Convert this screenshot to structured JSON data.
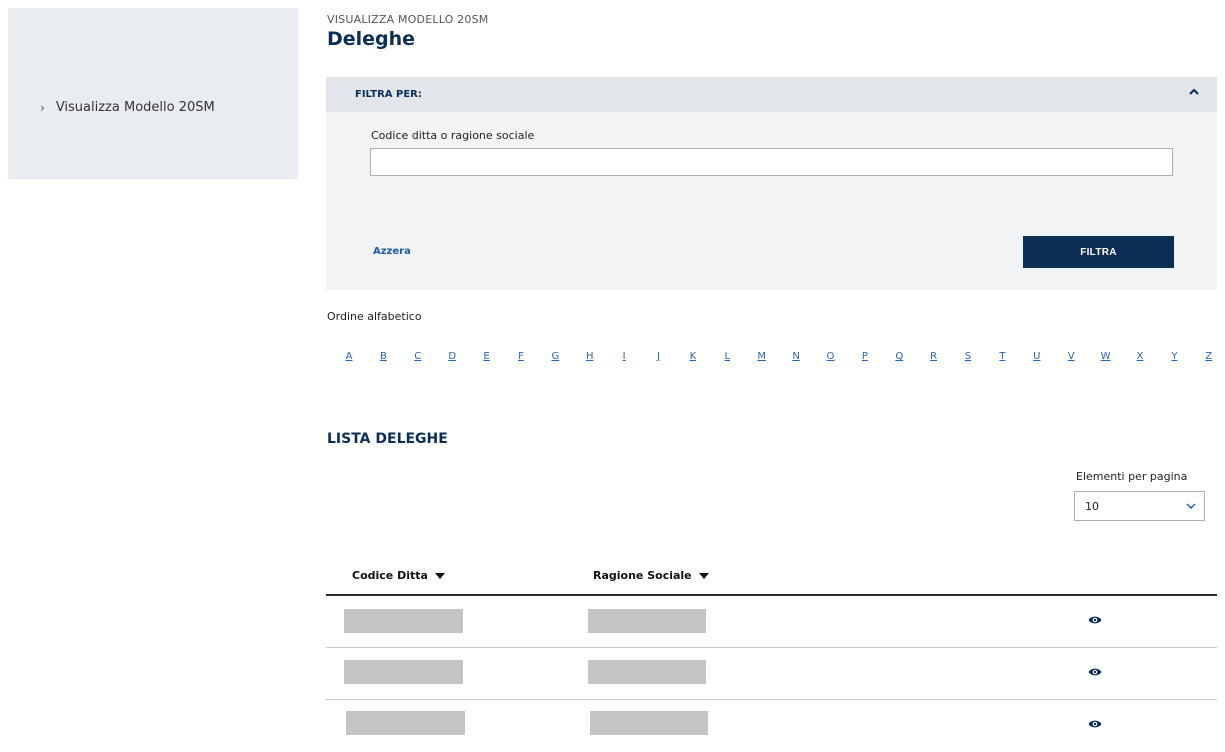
{
  "sidebar": {
    "items": [
      {
        "label": "Visualizza Modello 20SM",
        "icon": "chevron-right-icon"
      }
    ]
  },
  "header": {
    "breadcrumb": "VISUALIZZA MODELLO 20SM",
    "title": "Deleghe"
  },
  "filter": {
    "heading": "FILTRA PER:",
    "collapse_icon": "chevron-up-icon",
    "field_label": "Codice ditta o ragione sociale",
    "field_value": "",
    "field_placeholder": "",
    "reset_label": "Azzera",
    "submit_label": "FILTRA"
  },
  "alphabet": {
    "label": "Ordine alfabetico",
    "letters": [
      "A",
      "B",
      "C",
      "D",
      "E",
      "F",
      "G",
      "H",
      "I",
      "J",
      "K",
      "L",
      "M",
      "N",
      "O",
      "P",
      "Q",
      "R",
      "S",
      "T",
      "U",
      "V",
      "W",
      "X",
      "Y",
      "Z"
    ]
  },
  "list": {
    "title": "LISTA DELEGHE",
    "per_page_label": "Elementi per pagina",
    "per_page_value": "10",
    "columns": [
      {
        "label": "Codice Ditta",
        "sort_icon": "caret-down-icon"
      },
      {
        "label": "Ragione Sociale",
        "sort_icon": "caret-down-icon"
      }
    ],
    "row_count_visible": 3,
    "row_action_icon": "eye-icon"
  },
  "colors": {
    "primary": "#0b2e56",
    "link": "#2a63b4",
    "panel": "#f2f3f5",
    "panel_header": "#e2e5ea",
    "sidebar": "#e9ecf1",
    "redacted": "#c4c4c4"
  }
}
